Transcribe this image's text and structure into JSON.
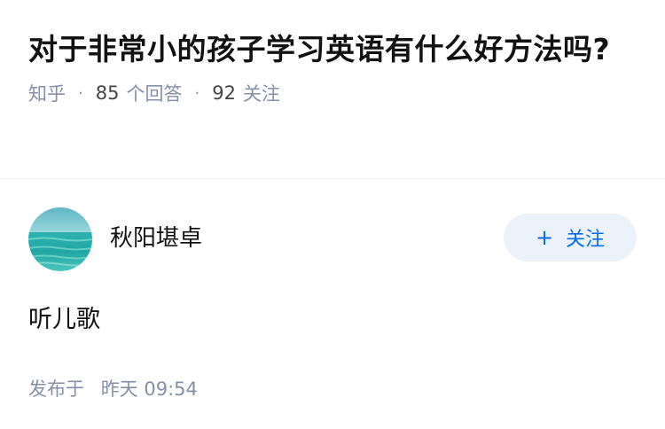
{
  "question": {
    "title": "对于非常小的孩子学习英语有什么好方法吗?",
    "source": "知乎",
    "answer_count": "85",
    "answer_label": "个回答",
    "follow_count": "92",
    "follow_label": "关注"
  },
  "answer": {
    "author_name": "秋阳堪卓",
    "avatar_icon": "avatar-ocean-image",
    "follow_button": {
      "icon": "plus-icon",
      "plus": "+",
      "label": "关注"
    },
    "content": "听儿歌",
    "publish_label": "发布于",
    "publish_time": "昨天 09:54"
  },
  "colors": {
    "title": "#121212",
    "meta": "#8590a6",
    "accent": "#056de8",
    "button_bg": "#ebf2fa"
  }
}
